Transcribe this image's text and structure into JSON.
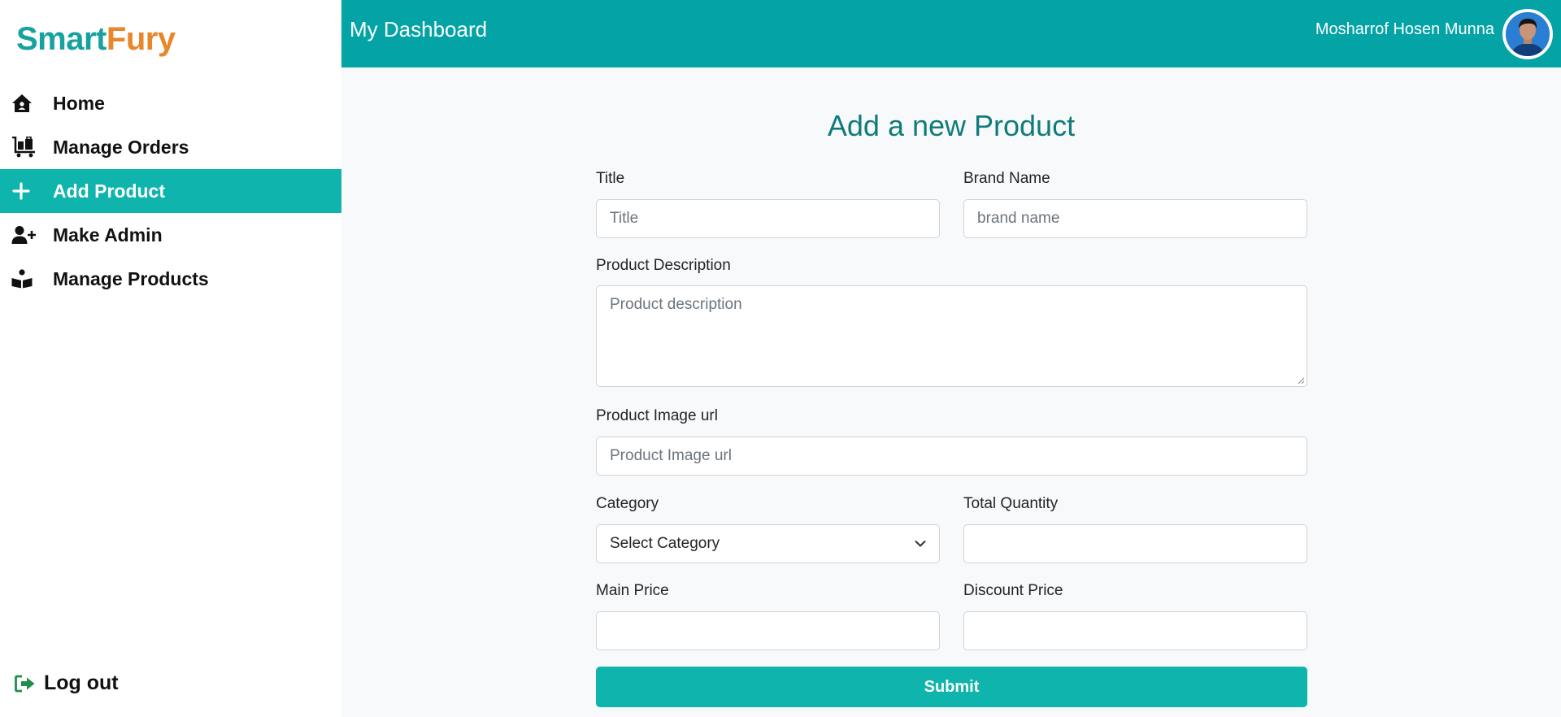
{
  "brand": {
    "part1": "Smart",
    "part2": "Fury"
  },
  "sidebar": {
    "items": [
      {
        "label": "Home",
        "icon": "home-icon"
      },
      {
        "label": "Manage Orders",
        "icon": "orders-cart-icon"
      },
      {
        "label": "Add Product",
        "icon": "plus-icon",
        "active": true
      },
      {
        "label": "Make Admin",
        "icon": "user-plus-icon"
      },
      {
        "label": "Manage Products",
        "icon": "boxes-icon"
      }
    ],
    "logout": {
      "label": "Log out",
      "icon": "sign-out-icon"
    }
  },
  "header": {
    "title": "My Dashboard",
    "user_name": "Mosharrof Hosen Munna",
    "avatar": "user-avatar"
  },
  "form": {
    "title": "Add a new Product",
    "fields": {
      "title": {
        "label": "Title",
        "placeholder": "Title",
        "value": ""
      },
      "brand": {
        "label": "Brand Name",
        "placeholder": "brand name",
        "value": ""
      },
      "description": {
        "label": "Product Description",
        "placeholder": "Product description",
        "value": ""
      },
      "image_url": {
        "label": "Product Image url",
        "placeholder": "Product Image url",
        "value": ""
      },
      "category": {
        "label": "Category",
        "selected": "Select Category"
      },
      "quantity": {
        "label": "Total Quantity",
        "value": ""
      },
      "main_price": {
        "label": "Main Price",
        "value": ""
      },
      "discount_price": {
        "label": "Discount Price",
        "value": ""
      }
    },
    "submit_label": "Submit"
  },
  "colors": {
    "accent": "#03a3a6",
    "active": "#0fb4ad",
    "brand_teal": "#17a2a0",
    "brand_orange": "#e8862a",
    "title_teal": "#0e7c7b"
  }
}
